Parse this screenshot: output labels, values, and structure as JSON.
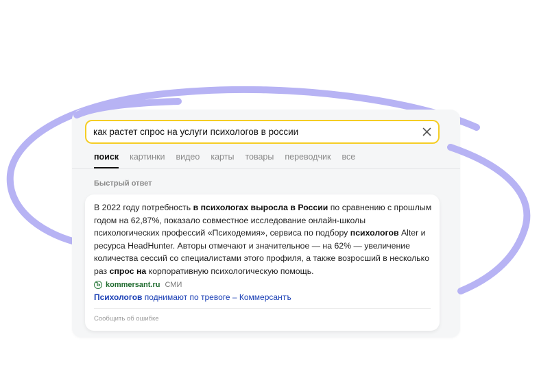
{
  "search": {
    "query": "как растет спрос на услуги психологов в россии",
    "clear_icon": "close-icon"
  },
  "tabs": [
    {
      "label": "поиск",
      "active": true
    },
    {
      "label": "картинки",
      "active": false
    },
    {
      "label": "видео",
      "active": false
    },
    {
      "label": "карты",
      "active": false
    },
    {
      "label": "товары",
      "active": false
    },
    {
      "label": "переводчик",
      "active": false
    },
    {
      "label": "все",
      "active": false
    }
  ],
  "quick_answer": {
    "title": "Быстрый ответ",
    "text_parts": [
      {
        "text": "В 2022 году потребность ",
        "bold": false
      },
      {
        "text": "в психологах выросла в России",
        "bold": true
      },
      {
        "text": " по сравнению с прошлым годом на 62,87%, показало совместное исследование онлайн-школы психологических профессий «Психодемия», сервиса по подбору ",
        "bold": false
      },
      {
        "text": "психологов",
        "bold": true
      },
      {
        "text": " Alter и ресурса HeadHunter. Авторы отмечают и значительное — на 62% — увеличение количества сессий со специалистами этого профиля, а также возросший в несколько раз ",
        "bold": false
      },
      {
        "text": "спрос на",
        "bold": true
      },
      {
        "text": " корпоративную психологическую помощь.",
        "bold": false
      }
    ],
    "source": {
      "icon": "kommersant-logo-icon",
      "icon_letter": "Ъ",
      "domain": "kommersant.ru",
      "tag": "СМИ"
    },
    "link_parts": [
      {
        "text": "Психологов",
        "bold": true
      },
      {
        "text": " поднимают по тревоге – Коммерсантъ",
        "bold": false
      }
    ],
    "report_error": "Сообщить об ошибке"
  },
  "colors": {
    "search_border": "#f5cd24",
    "ring": "#b7b3f4",
    "link": "#1a3fb5",
    "source_green": "#1f6b2e"
  }
}
